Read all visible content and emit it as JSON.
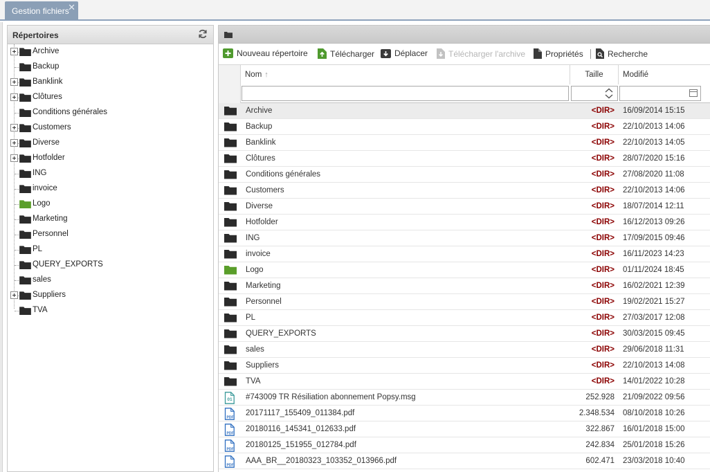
{
  "colors": {
    "folder": "#2b2b2b",
    "folder_highlight": "#5a9e2a",
    "dir_tag": "#8b0000",
    "tab_bg": "#8b9fb6"
  },
  "tab": {
    "label": "Gestion fichiers",
    "close": "✕"
  },
  "left_panel": {
    "title": "Répertoires",
    "refresh_icon": "refresh-icon",
    "tree": [
      {
        "label": "Archive",
        "expandable": true
      },
      {
        "label": "Backup",
        "expandable": false
      },
      {
        "label": "Banklink",
        "expandable": true
      },
      {
        "label": "Clôtures",
        "expandable": true
      },
      {
        "label": "Conditions générales",
        "expandable": false
      },
      {
        "label": "Customers",
        "expandable": true
      },
      {
        "label": "Diverse",
        "expandable": true
      },
      {
        "label": "Hotfolder",
        "expandable": true
      },
      {
        "label": "ING",
        "expandable": false
      },
      {
        "label": "invoice",
        "expandable": false
      },
      {
        "label": "Logo",
        "expandable": false,
        "highlight": true
      },
      {
        "label": "Marketing",
        "expandable": false
      },
      {
        "label": "Personnel",
        "expandable": false
      },
      {
        "label": "PL",
        "expandable": false
      },
      {
        "label": "QUERY_EXPORTS",
        "expandable": false
      },
      {
        "label": "sales",
        "expandable": false
      },
      {
        "label": "Suppliers",
        "expandable": true
      },
      {
        "label": "TVA",
        "expandable": false
      }
    ]
  },
  "toolbar": {
    "new_dir": "Nouveau répertoire",
    "upload": "Télécharger",
    "move": "Déplacer",
    "download_archive": "Télécharger l'archive",
    "properties": "Propriétés",
    "search": "Recherche"
  },
  "grid": {
    "columns": {
      "name": "Nom",
      "size": "Taille",
      "modified": "Modifié"
    },
    "filters": {
      "name": "",
      "size": "",
      "modified": ""
    },
    "rows": [
      {
        "type": "folder",
        "name": "Archive",
        "size": "<DIR>",
        "modified": "16/09/2014 15:15",
        "selected": true
      },
      {
        "type": "folder",
        "name": "Backup",
        "size": "<DIR>",
        "modified": "22/10/2013 14:06"
      },
      {
        "type": "folder",
        "name": "Banklink",
        "size": "<DIR>",
        "modified": "22/10/2013 14:05"
      },
      {
        "type": "folder",
        "name": "Clôtures",
        "size": "<DIR>",
        "modified": "28/07/2020 15:16"
      },
      {
        "type": "folder",
        "name": "Conditions générales",
        "size": "<DIR>",
        "modified": "27/08/2020 11:08"
      },
      {
        "type": "folder",
        "name": "Customers",
        "size": "<DIR>",
        "modified": "22/10/2013 14:06"
      },
      {
        "type": "folder",
        "name": "Diverse",
        "size": "<DIR>",
        "modified": "18/07/2014 12:11"
      },
      {
        "type": "folder",
        "name": "Hotfolder",
        "size": "<DIR>",
        "modified": "16/12/2013 09:26"
      },
      {
        "type": "folder",
        "name": "ING",
        "size": "<DIR>",
        "modified": "17/09/2015 09:46"
      },
      {
        "type": "folder",
        "name": "invoice",
        "size": "<DIR>",
        "modified": "16/11/2023 14:23"
      },
      {
        "type": "folder-green",
        "name": "Logo",
        "size": "<DIR>",
        "modified": "01/11/2024 18:45"
      },
      {
        "type": "folder",
        "name": "Marketing",
        "size": "<DIR>",
        "modified": "16/02/2021 12:39"
      },
      {
        "type": "folder",
        "name": "Personnel",
        "size": "<DIR>",
        "modified": "19/02/2021 15:27"
      },
      {
        "type": "folder",
        "name": "PL",
        "size": "<DIR>",
        "modified": "27/03/2017 12:08"
      },
      {
        "type": "folder",
        "name": "QUERY_EXPORTS",
        "size": "<DIR>",
        "modified": "30/03/2015 09:45"
      },
      {
        "type": "folder",
        "name": "sales",
        "size": "<DIR>",
        "modified": "29/06/2018 11:31"
      },
      {
        "type": "folder",
        "name": "Suppliers",
        "size": "<DIR>",
        "modified": "22/10/2013 14:08"
      },
      {
        "type": "folder",
        "name": "TVA",
        "size": "<DIR>",
        "modified": "14/01/2022 10:28"
      },
      {
        "type": "msg",
        "name": "#743009 TR Résiliation abonnement Popsy.msg",
        "size": "252.928",
        "modified": "21/09/2022 09:56"
      },
      {
        "type": "pdf",
        "name": "20171117_155409_011384.pdf",
        "size": "2.348.534",
        "modified": "08/10/2018 10:26"
      },
      {
        "type": "pdf",
        "name": "20180116_145341_012633.pdf",
        "size": "322.867",
        "modified": "16/01/2018 15:00"
      },
      {
        "type": "pdf",
        "name": "20180125_151955_012784.pdf",
        "size": "242.834",
        "modified": "25/01/2018 15:26"
      },
      {
        "type": "pdf",
        "name": "AAA_BR__20180323_103352_013966.pdf",
        "size": "602.471",
        "modified": "23/03/2018 10:40"
      }
    ]
  }
}
